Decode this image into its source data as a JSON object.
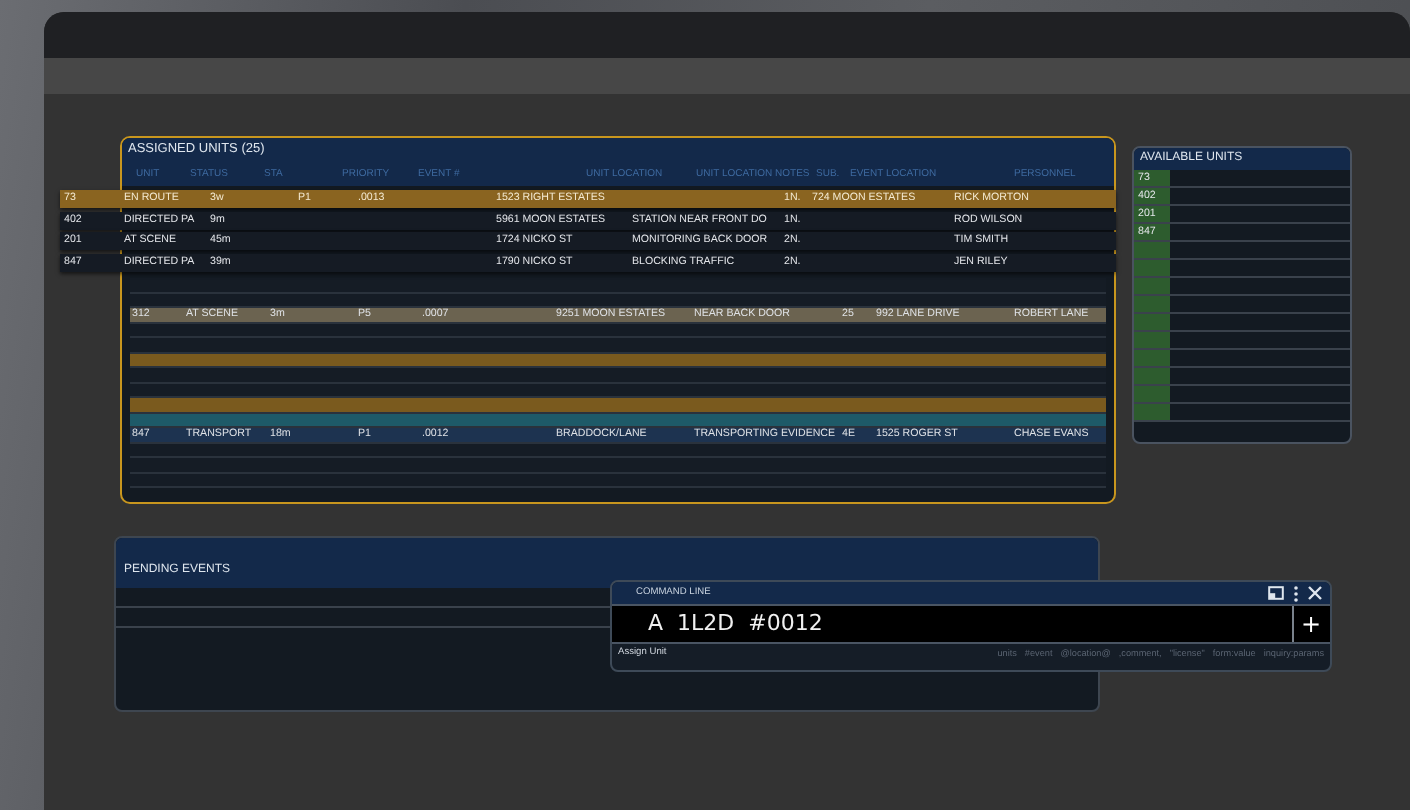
{
  "assigned_units": {
    "title": "ASSIGNED UNITS (25)",
    "columns": [
      "UNIT",
      "STATUS",
      "STA",
      "PRIORITY",
      "EVENT #",
      "UNIT LOCATION",
      "UNIT LOCATION NOTES",
      "SUB.",
      "EVENT LOCATION",
      "PERSONNEL"
    ],
    "dragged_rows": [
      {
        "selected": true,
        "unit": "73",
        "status": "EN ROUTE",
        "time": "3w",
        "priority": "P1",
        "event": ".0013",
        "location": "1523 RIGHT ESTATES",
        "sub": "1N.",
        "event_location": "724 MOON ESTATES",
        "personnel": "RICK MORTON"
      },
      {
        "selected": false,
        "unit": "402",
        "status": "DIRECTED PA",
        "time": "9m",
        "location": "5961 MOON ESTATES",
        "notes": "STATION NEAR FRONT DO",
        "sub": "1N.",
        "personnel": "ROD WILSON"
      },
      {
        "selected": false,
        "unit": "201",
        "status": "AT SCENE",
        "time": "45m",
        "location": "1724 NICKO ST",
        "notes": "MONITORING BACK DOOR",
        "sub": "2N.",
        "personnel": "TIM SMITH"
      },
      {
        "selected": false,
        "unit": "847",
        "status": "DIRECTED PA",
        "time": "39m",
        "location": "1790 NICKO ST",
        "notes": "BLOCKING TRAFFIC",
        "sub": "2N.",
        "personnel": "JEN RILEY"
      }
    ],
    "rows": [
      {
        "color": "#151c25"
      },
      {
        "color": "#151c25"
      },
      {
        "color": "#6b6350",
        "unit": "312",
        "status": "AT SCENE",
        "time": "3m",
        "priority": "P5",
        "event": ".0007",
        "location": "9251 MOON ESTATES",
        "notes": "NEAR BACK DOOR",
        "sub": "25",
        "event_location": "992 LANE DRIVE",
        "personnel": "ROBERT LANE"
      },
      {
        "color": "#151c25"
      },
      {
        "color": "#151c25"
      },
      {
        "color": "#7a5a1e"
      },
      {
        "color": "#151c25"
      },
      {
        "color": "#151c25"
      },
      {
        "color": "#7a5a1e"
      },
      {
        "color": "#1e5a68"
      },
      {
        "color": "#1d3350",
        "unit": "847",
        "status": "TRANSPORT",
        "time": "18m",
        "priority": "P1",
        "event": ".0012",
        "location": "BRADDOCK/LANE",
        "notes": "TRANSPORTING EVIDENCE",
        "sub": "4E",
        "event_location": "1525 ROGER ST",
        "personnel": "CHASE EVANS"
      },
      {
        "color": "#151c25"
      },
      {
        "color": "#151c25"
      },
      {
        "color": "#151c25"
      }
    ]
  },
  "available_units": {
    "title": "AVAILABLE UNITS",
    "units": [
      "73",
      "402",
      "201",
      "847"
    ]
  },
  "pending_events": {
    "title": "PENDING EVENTS"
  },
  "command_line": {
    "title": "COMMAND LINE",
    "value": "A  1L2D  #0012",
    "plus": "+",
    "mode": "Assign Unit",
    "hints": [
      "units",
      "#event",
      "@location@",
      ",comment,",
      "\"license\"",
      "form:value",
      "inquiry:params"
    ]
  }
}
